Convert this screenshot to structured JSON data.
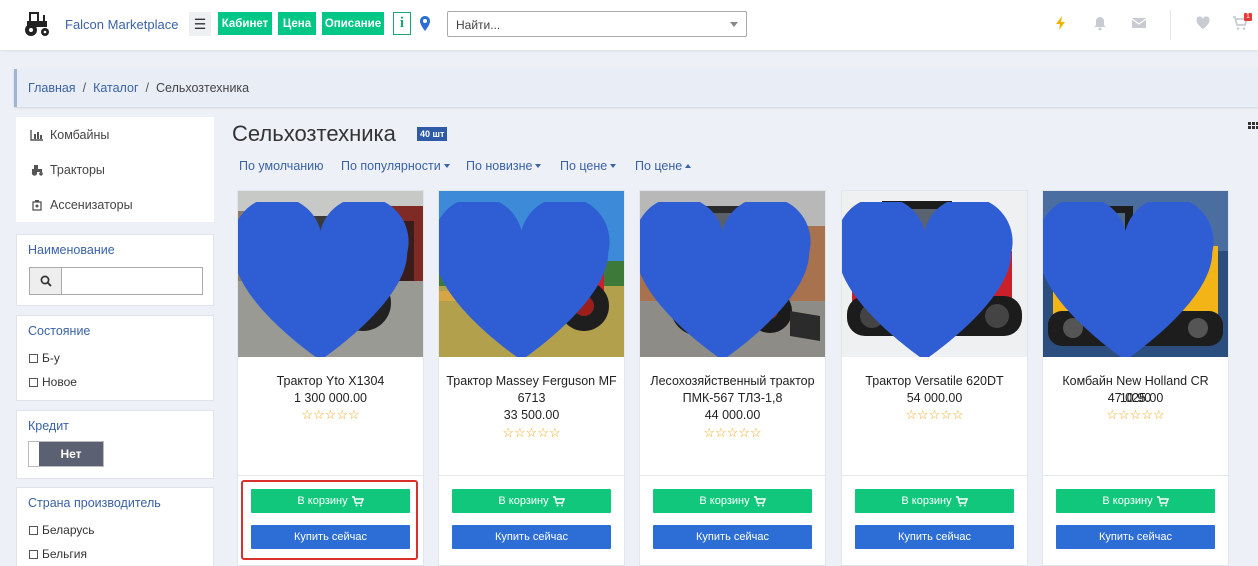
{
  "header": {
    "brand": "Falcon Marketplace",
    "nav": [
      "Кабинет",
      "Цена",
      "Описание"
    ],
    "info_label": "i",
    "search_placeholder": "Найти...",
    "cart_count": "1",
    "accent": "#00c785"
  },
  "breadcrumb": {
    "items": [
      "Главная",
      "Каталог"
    ],
    "current": "Сельхозтехника"
  },
  "sidebar": {
    "categories": [
      "Комбайны",
      "Тракторы",
      "Ассенизаторы"
    ],
    "filters": {
      "name_title": "Наименование",
      "state_title": "Состояние",
      "state_options": [
        "Б-у",
        "Новое"
      ],
      "credit_title": "Кредит",
      "credit_value": "Нет",
      "country_title": "Страна производитель",
      "country_options": [
        "Беларусь",
        "Бельгия"
      ]
    }
  },
  "main": {
    "title": "Сельхозтехника",
    "count": "40 шт",
    "sort": [
      "По умолчанию",
      "По популярности",
      "По новизне",
      "По цене",
      "По цене"
    ]
  },
  "products": [
    {
      "name": "Трактор Yto X1304",
      "price": "1 300 000.00",
      "rating": 0
    },
    {
      "name": "Трактор Massey Ferguson MF 6713",
      "price": "33 500.00",
      "rating": 0
    },
    {
      "name": "Лесохозяйственный трактор ПМК-567 ТЛЗ-1,8",
      "price": "44 000.00",
      "rating": 0
    },
    {
      "name": "Трактор Versatile 620DT",
      "price": "54 000.00",
      "rating": 0
    },
    {
      "name": "Комбайн New Holland CR 10.90",
      "price": "47 025.00",
      "rating": 0
    }
  ],
  "buttons": {
    "add_to_cart": "В корзину",
    "buy_now": "Купить сейчас"
  }
}
